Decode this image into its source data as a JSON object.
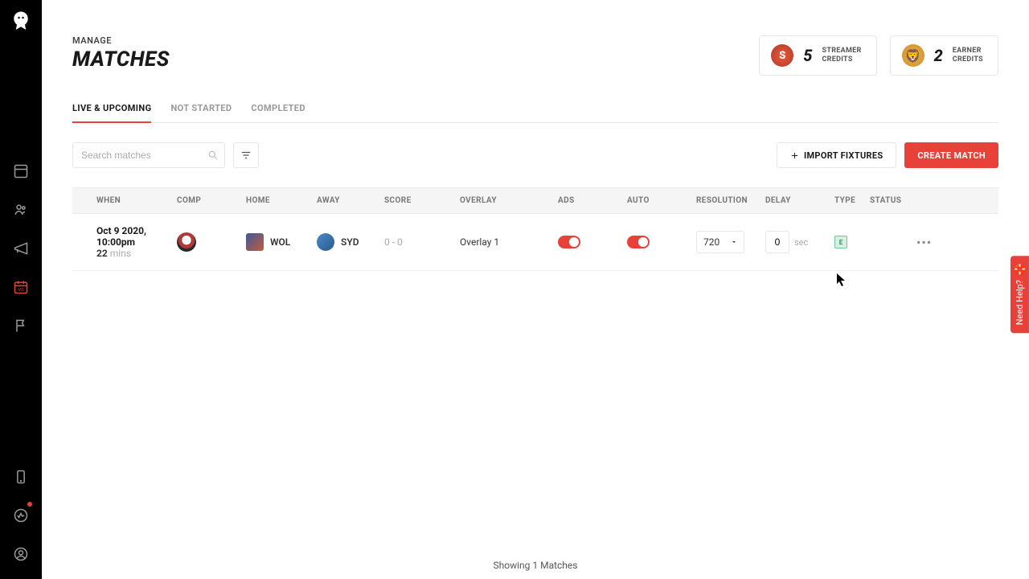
{
  "header": {
    "eyebrow": "MANAGE",
    "title": "MATCHES"
  },
  "credits": [
    {
      "count": "5",
      "line1": "STREAMER",
      "line2": "CREDITS",
      "badge_bg": "#c8503a",
      "badge_letter": "S"
    },
    {
      "count": "2",
      "line1": "EARNER",
      "line2": "CREDITS",
      "badge_bg": "#d89a2a",
      "badge_emoji": "🦁"
    }
  ],
  "tabs": [
    {
      "label": "LIVE & UPCOMING",
      "active": true
    },
    {
      "label": "NOT STARTED",
      "active": false
    },
    {
      "label": "COMPLETED",
      "active": false
    }
  ],
  "search": {
    "placeholder": "Search matches"
  },
  "buttons": {
    "import": "IMPORT FIXTURES",
    "create": "CREATE MATCH"
  },
  "columns": {
    "when": "WHEN",
    "comp": "COMP",
    "home": "HOME",
    "away": "AWAY",
    "score": "SCORE",
    "overlay": "OVERLAY",
    "ads": "ADS",
    "auto": "AUTO",
    "resolution": "RESOLUTION",
    "delay": "DELAY",
    "type": "TYPE",
    "status": "STATUS"
  },
  "row": {
    "when_date": "Oct 9 2020, 10:00pm",
    "when_rel_num": "22",
    "when_rel_unit": " mins",
    "home": "WOL",
    "away": "SYD",
    "score": "0 - 0",
    "overlay": "Overlay 1",
    "ads_on": true,
    "auto_on": true,
    "resolution": "720",
    "delay_value": "0",
    "delay_unit": "sec",
    "type_badge": "E"
  },
  "footer": "Showing 1 Matches",
  "help": "Need Help?",
  "colors": {
    "accent": "#e8413a"
  }
}
